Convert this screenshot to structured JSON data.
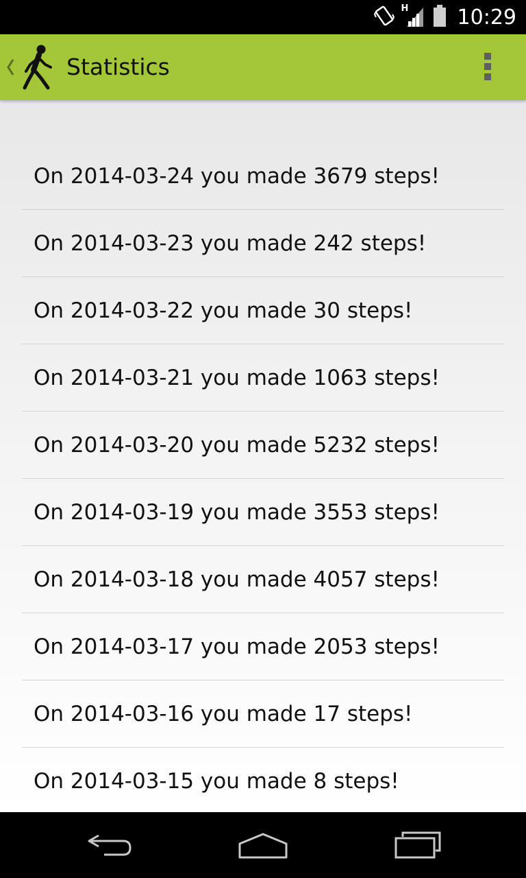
{
  "status_bar": {
    "time": "10:29",
    "network_label": "H",
    "icons": [
      "vibrate-icon",
      "signal-icon",
      "battery-icon"
    ]
  },
  "action_bar": {
    "title": "Statistics",
    "background_color": "#a4c639",
    "icons": [
      "up-chevron-icon",
      "walking-person-icon",
      "overflow-menu-icon"
    ]
  },
  "stats": [
    {
      "text": "On 2014-03-24 you made 3679 steps!"
    },
    {
      "text": "On 2014-03-23 you made 242 steps!"
    },
    {
      "text": "On 2014-03-22 you made 30 steps!"
    },
    {
      "text": "On 2014-03-21 you made 1063 steps!"
    },
    {
      "text": "On 2014-03-20 you made 5232 steps!"
    },
    {
      "text": "On 2014-03-19 you made 3553 steps!"
    },
    {
      "text": "On 2014-03-18 you made 4057 steps!"
    },
    {
      "text": "On 2014-03-17 you made 2053 steps!"
    },
    {
      "text": "On 2014-03-16 you made 17 steps!"
    },
    {
      "text": "On 2014-03-15 you made 8 steps!"
    }
  ],
  "nav_bar": {
    "icons": [
      "back-icon",
      "home-icon",
      "recent-apps-icon"
    ]
  }
}
